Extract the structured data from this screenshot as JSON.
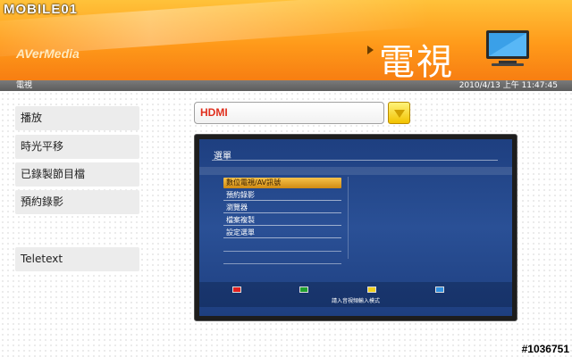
{
  "watermark": "MOBILE01",
  "brand": "AVerMedia",
  "header": {
    "title": "電視"
  },
  "status": {
    "section": "電視",
    "datetime": "2010/4/13 上午 11:47:45"
  },
  "sidebar": {
    "items": [
      {
        "label": "播放"
      },
      {
        "label": "時光平移"
      },
      {
        "label": "已錄製節目檔"
      },
      {
        "label": "預約錄影"
      },
      {
        "label": "Teletext"
      }
    ]
  },
  "source": {
    "value": "HDMI",
    "button_icon": "dropdown-triangle-icon"
  },
  "preview": {
    "title": "選單",
    "menu": [
      {
        "label": "數位電視/AV訊號"
      },
      {
        "label": "預約錄影"
      },
      {
        "label": "瀏覽器"
      },
      {
        "label": "檔案複製"
      },
      {
        "label": "設定選單"
      }
    ],
    "hint": "請入音視頻輸入模式",
    "color_keys": [
      "#e02020",
      "#20a030",
      "#f0d020",
      "#3090e0"
    ]
  },
  "photo_id": "#1036751"
}
